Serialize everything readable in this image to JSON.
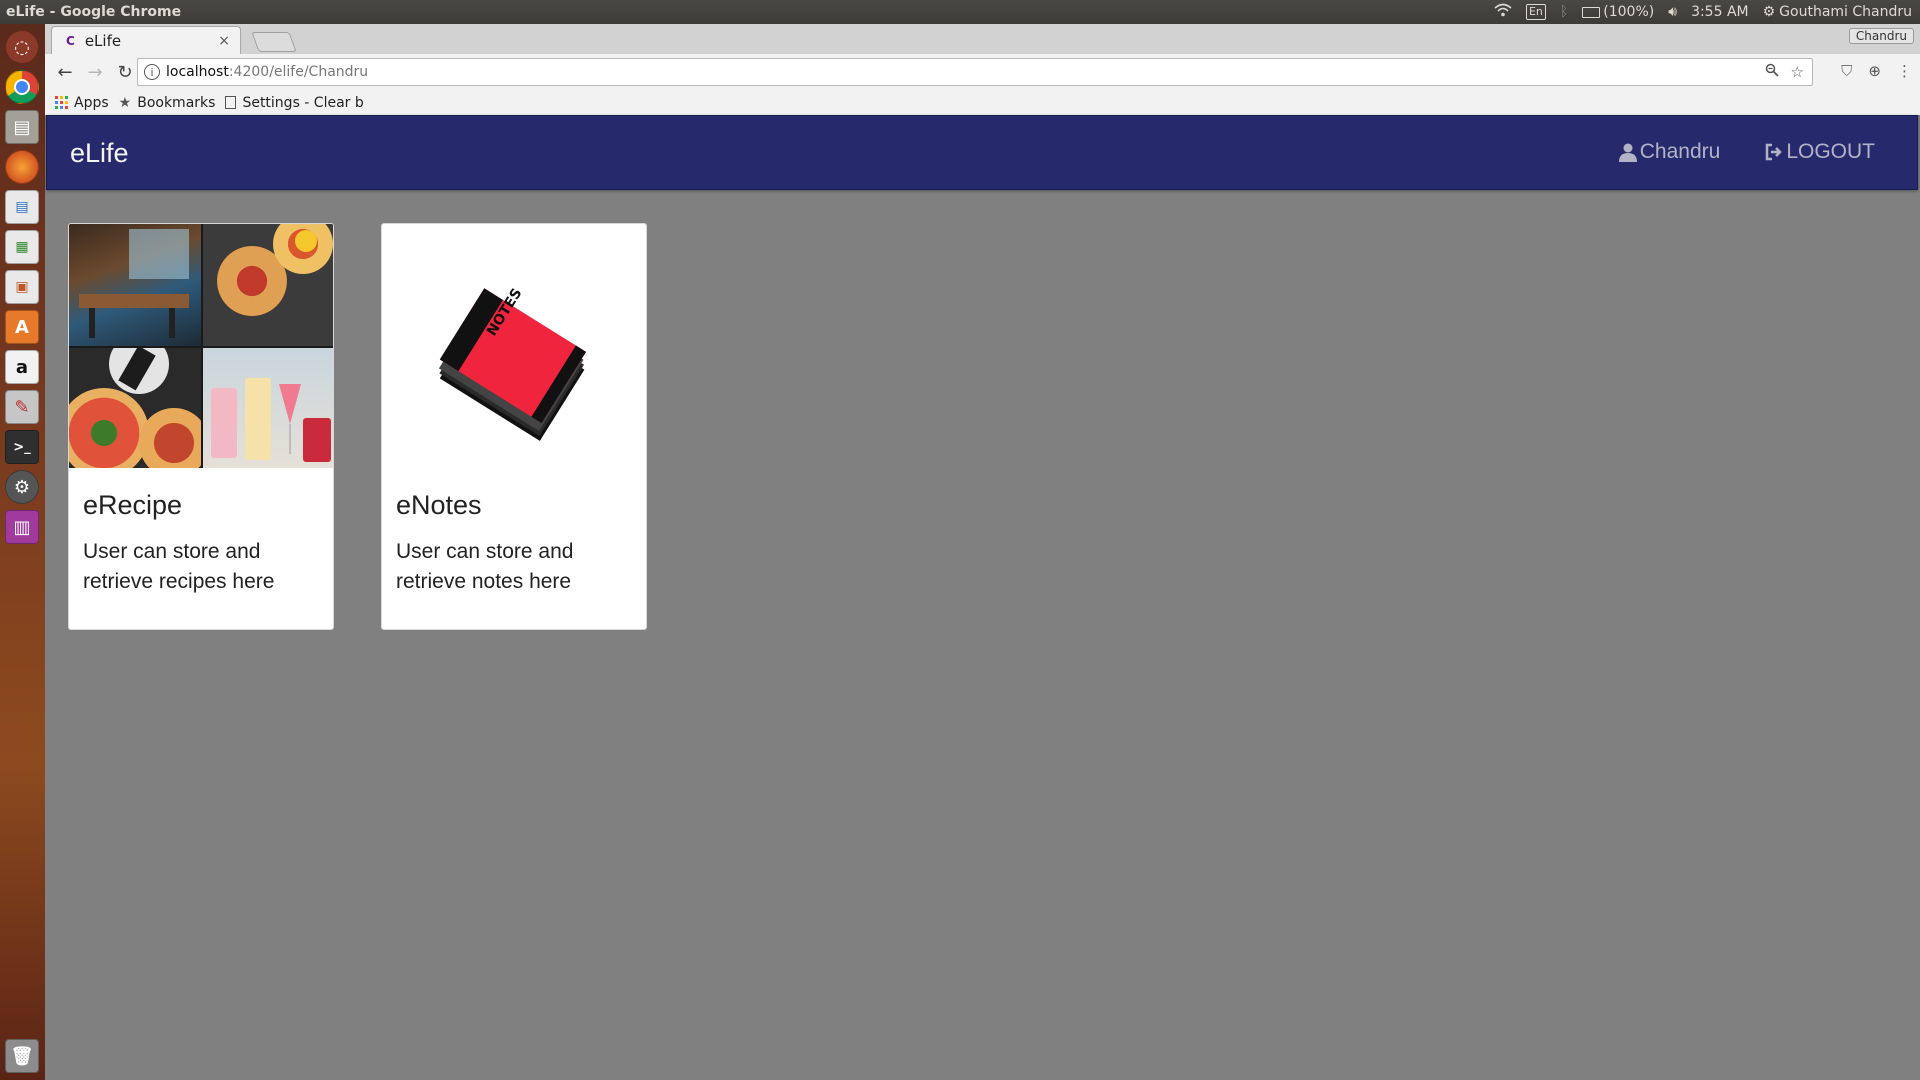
{
  "os": {
    "window_title": "eLife - Google Chrome",
    "tray_lang": "En",
    "battery": "(100%)",
    "clock": "3:55 AM",
    "user": "Gouthami Chandru"
  },
  "browser": {
    "tab_title": "eLife",
    "tab_favicon": "C",
    "tab_close": "×",
    "profile_badge": "Chandru",
    "url_host": "localhost",
    "url_path": ":4200/elife/Chandru",
    "bookmarks": {
      "apps": "Apps",
      "bookmarks": "Bookmarks",
      "settings": "Settings - Clear b"
    }
  },
  "app": {
    "brand": "eLife",
    "nav_user": "Chandru",
    "nav_logout": "LOGOUT",
    "cards": [
      {
        "title": "eRecipe",
        "description": "User can store and retrieve recipes here"
      },
      {
        "title": "eNotes",
        "description": "User can store and retrieve notes here"
      }
    ],
    "notes_cover_text": "NOTES"
  },
  "colors": {
    "navbar": "#27296d",
    "page_background": "#808080",
    "nav_link": "#b3b3c6",
    "notes_red": "#f0243c"
  }
}
